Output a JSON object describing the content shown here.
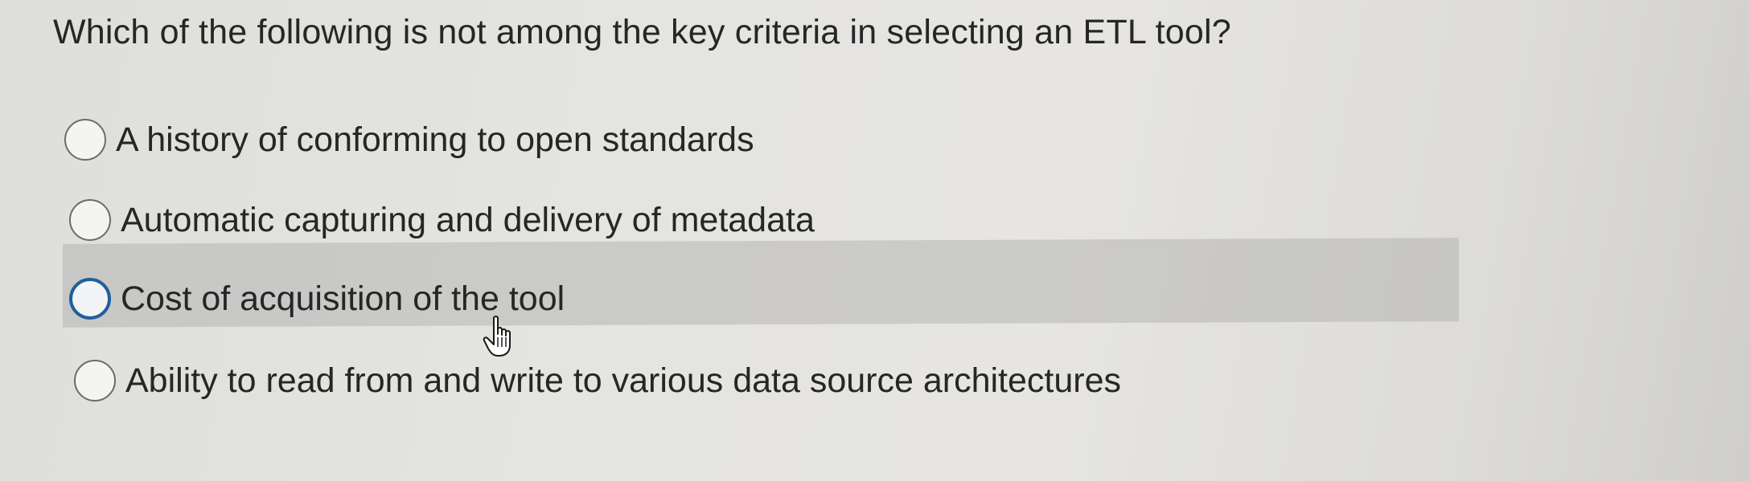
{
  "question": {
    "text": "Which of the following is not among the key criteria in selecting an ETL tool?"
  },
  "options": [
    {
      "label": "A history of conforming to open standards",
      "selected": false
    },
    {
      "label": "Automatic capturing and delivery of metadata",
      "selected": false
    },
    {
      "label": "Cost of acquisition of the tool",
      "selected": false,
      "hovered": true
    },
    {
      "label": "Ability to read from and write to various data source architectures",
      "selected": false
    }
  ],
  "colors": {
    "text": "#262626",
    "hover_highlight": "#b4b4b2",
    "focus_ring": "#1f5f9c"
  },
  "icons": {
    "cursor": "hand-pointer-icon",
    "radio": "radio-circle-icon"
  }
}
